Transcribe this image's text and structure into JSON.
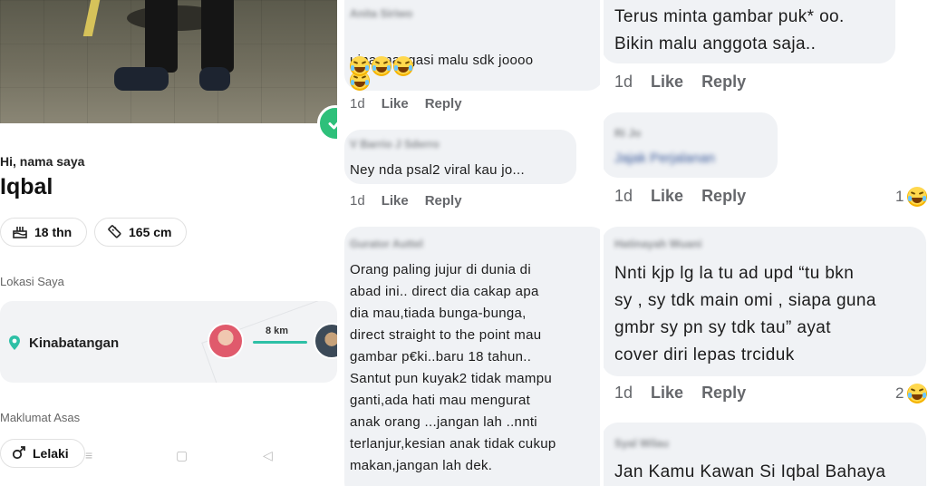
{
  "profile": {
    "greeting": "Hi, nama saya",
    "name": "Iqbal",
    "age_chip": "18 thn",
    "height_chip": "165 cm",
    "location_section": "Lokasi Saya",
    "location": "Kinabatangan",
    "distance": "8 km",
    "basic_section": "Maklumat Asas",
    "gender_chip": "Lelaki",
    "icons": [
      "cake-icon",
      "ruler-icon",
      "location-pin-icon",
      "male-icon",
      "verified-check-icon"
    ]
  },
  "panel2": {
    "comments": [
      {
        "author": "Anita Siriwo",
        "text": "uina mangasi malu sdk joooo",
        "emoji_line": true,
        "time": "1d",
        "like": "Like",
        "reply": "Reply"
      },
      {
        "author": "V Barrio J Sderro",
        "text": "Ney nda psal2 viral kau jo...",
        "time": "1d",
        "like": "Like",
        "reply": "Reply"
      },
      {
        "author": "Gurator Auttel",
        "lines": [
          "Orang paling jujur di dunia di",
          "abad ini.. direct dia cakap apa",
          "dia mau,tiada bunga-bunga,",
          "direct straight to the point mau",
          "gambar p€ki..baru 18 tahun..",
          "Santut pun kuyak2 tidak mampu",
          "ganti,ada hati mau mengurat",
          "anak orang ...jangan lah ..nnti",
          "terlanjur,kesian anak tidak cukup",
          "makan,jangan lah dek."
        ]
      }
    ]
  },
  "panel3": {
    "comments": [
      {
        "lines": [
          "Terus minta gambar puk* oo.",
          "Bikin malu anggota saja.."
        ],
        "time": "1d",
        "like": "Like",
        "reply": "Reply"
      },
      {
        "author": "Ri Jo",
        "link": "Jajak Perjalanan",
        "time": "1d",
        "like": "Like",
        "reply": "Reply",
        "reaction_count": "1"
      },
      {
        "author": "Hatinayah Wuani",
        "lines": [
          "Nnti kjp lg la tu ad upd “tu bkn",
          "sy , sy tdk main omi , siapa guna",
          "gmbr sy pn sy tdk tau” ayat",
          "cover diri lepas trciduk"
        ],
        "time": "1d",
        "like": "Like",
        "reply": "Reply",
        "reaction_count": "2"
      },
      {
        "author": "Syal Wilau",
        "text": "Jan Kamu Kawan Si Iqbal Bahaya"
      }
    ]
  },
  "colors": {
    "accent": "#2ec07a",
    "bubble": "#f0f2f5",
    "meta": "#65676b",
    "distance_line": "#2ec0a6"
  }
}
